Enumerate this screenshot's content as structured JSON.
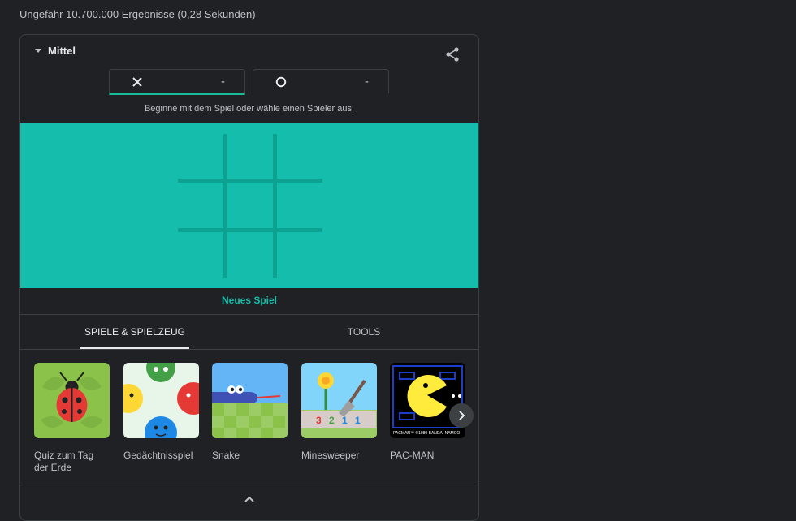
{
  "search": {
    "result_stats": "Ungefähr 10.700.000 Ergebnisse (0,28 Sekunden)"
  },
  "game": {
    "difficulty": "Mittel",
    "players": [
      {
        "mark": "X",
        "score": "-"
      },
      {
        "mark": "O",
        "score": "-"
      }
    ],
    "hint": "Beginne mit dem Spiel oder wähle einen Spieler aus.",
    "new_game_label": "Neues Spiel",
    "board_color": "#14bdac",
    "accent_color": "#14bdac"
  },
  "tabs": {
    "games": "SPIELE & SPIELZEUG",
    "tools": "TOOLS"
  },
  "games": [
    {
      "name": "Quiz zum Tag der Erde",
      "icon": "ladybug-icon"
    },
    {
      "name": "Gedächtnisspiel",
      "icon": "memory-faces-icon"
    },
    {
      "name": "Snake",
      "icon": "snake-icon"
    },
    {
      "name": "Minesweeper",
      "icon": "flower-shovel-icon"
    },
    {
      "name": "PAC-MAN",
      "icon": "pacman-icon",
      "caption": "PACMAN™ ©1980 BANDAI NAMCO"
    }
  ]
}
